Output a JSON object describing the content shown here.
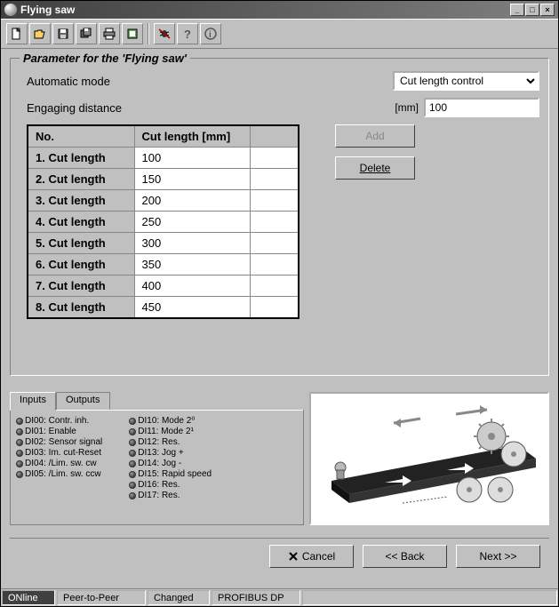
{
  "window": {
    "title": "Flying saw"
  },
  "toolbar": {
    "icons": [
      "new-file-icon",
      "open-icon",
      "save-icon",
      "save-all-icon",
      "print-icon",
      "module-icon",
      "bug-icon",
      "help-icon",
      "info-icon"
    ]
  },
  "group": {
    "title": "Parameter for the 'Flying saw'",
    "mode_label": "Automatic mode",
    "mode_value": "Cut length control",
    "mode_options": [
      "Cut length control"
    ],
    "dist_label": "Engaging distance",
    "dist_unit": "[mm]",
    "dist_value": "100",
    "table": {
      "headers": [
        "No.",
        "Cut length [mm]"
      ],
      "rows": [
        {
          "label": "1. Cut length",
          "val": "100"
        },
        {
          "label": "2. Cut length",
          "val": "150"
        },
        {
          "label": "3. Cut length",
          "val": "200"
        },
        {
          "label": "4. Cut length",
          "val": "250"
        },
        {
          "label": "5. Cut length",
          "val": "300"
        },
        {
          "label": "6. Cut length",
          "val": "350"
        },
        {
          "label": "7. Cut length",
          "val": "400"
        },
        {
          "label": "8. Cut length",
          "val": "450"
        }
      ]
    },
    "add_btn": "Add",
    "delete_btn": "Delete"
  },
  "io": {
    "tabs": [
      "Inputs",
      "Outputs"
    ],
    "col1": [
      "DI00: Contr. inh.",
      "DI01: Enable",
      "DI02: Sensor signal",
      "DI03: Im. cut-Reset",
      "DI04: /Lim. sw. cw",
      "DI05: /Lim. sw. ccw"
    ],
    "col2": [
      "DI10: Mode 2⁰",
      "DI11: Mode 2¹",
      "DI12: Res.",
      "DI13: Jog +",
      "DI14: Jog -",
      "DI15: Rapid speed",
      "DI16: Res.",
      "DI17: Res."
    ]
  },
  "nav": {
    "cancel": "Cancel",
    "back": "<< Back",
    "next": "Next >>"
  },
  "status": {
    "online": "ONline",
    "peer": "Peer-to-Peer",
    "changed": "Changed",
    "bus": "PROFIBUS DP"
  }
}
